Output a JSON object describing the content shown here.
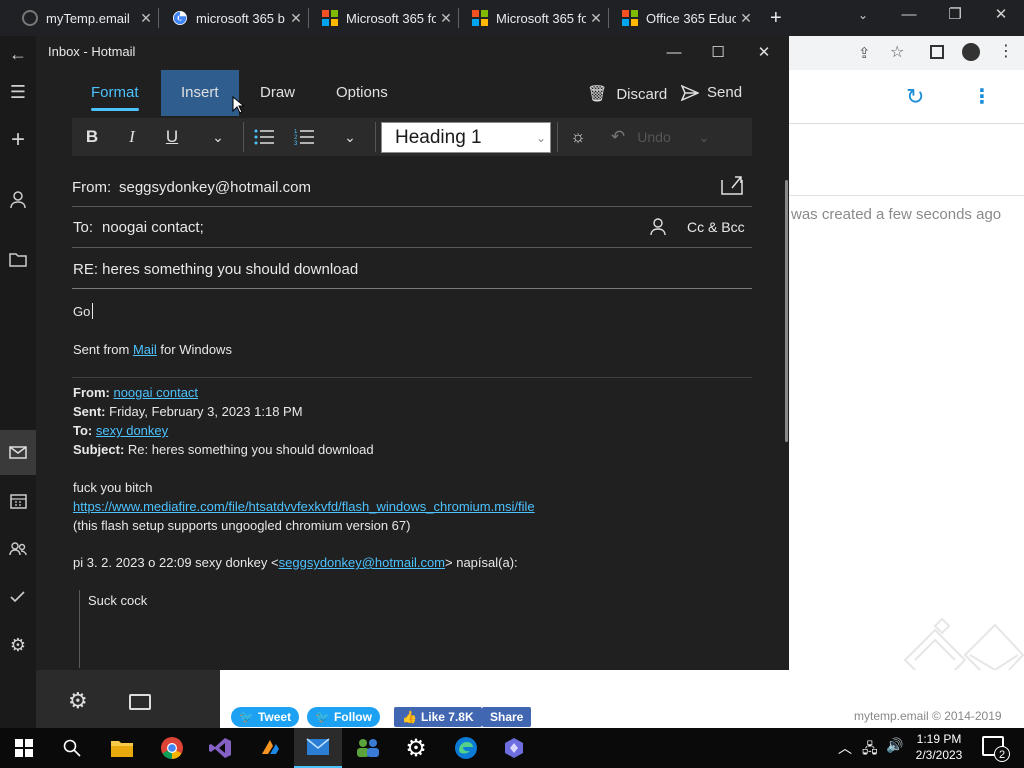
{
  "browser": {
    "tabs": [
      {
        "title": "myTemp.email",
        "icon": "mytemp-icon"
      },
      {
        "title": "microsoft 365 b",
        "icon": "google-icon"
      },
      {
        "title": "Microsoft 365 fo",
        "icon": "microsoft-icon"
      },
      {
        "title": "Microsoft 365 fo",
        "icon": "microsoft-icon"
      },
      {
        "title": "Office 365 Educ",
        "icon": "microsoft-icon"
      }
    ],
    "new_tab": "+"
  },
  "page": {
    "created_message": "was created a few seconds ago",
    "social": {
      "tweet": "Tweet",
      "follow": "Follow",
      "like": "Like 7.8K",
      "share": "Share"
    },
    "copyright": "mytemp.email © 2014-2019"
  },
  "compose": {
    "window_title": "Inbox - Hotmail",
    "ribbon_tabs": [
      "Format",
      "Insert",
      "Draw",
      "Options"
    ],
    "discard_label": "Discard",
    "send_label": "Send",
    "style_value": "Heading 1",
    "undo_label": "Undo",
    "from_label": "From:",
    "from_value": "seggsydonkey@hotmail.com",
    "to_label": "To:",
    "to_value": "noogai contact;",
    "cc_bcc_label": "Cc & Bcc",
    "subject": "RE: heres something you should download",
    "body_typed": "Go",
    "signature_prefix": "Sent from ",
    "signature_link": "Mail",
    "signature_suffix": " for Windows",
    "quoted": {
      "from_label": "From:",
      "from_value": "noogai contact",
      "sent_label": "Sent:",
      "sent_value": "Friday, February 3, 2023 1:18 PM",
      "to_label": "To:",
      "to_value": "sexy donkey",
      "subject_label": "Subject:",
      "subject_value": "Re: heres something you should download",
      "line1": "fuck you bitch",
      "url": "https://www.mediafire.com/file/htsatdvvfexkvfd/flash_windows_chromium.msi/file",
      "line3": "(this flash setup supports ungoogled chromium version 67)",
      "reply_prefix": "pi 3. 2. 2023 o 22:09 sexy donkey <",
      "reply_email": "seggsydonkey@hotmail.com",
      "reply_suffix": "> napísal(a):",
      "inner_quote": "Suck cock"
    }
  },
  "taskbar": {
    "time": "1:19 PM",
    "date": "2/3/2023",
    "notification_count": "2"
  },
  "colors": {
    "accent": "#4cc2ff",
    "insert_hover": "#2e5d8e"
  }
}
